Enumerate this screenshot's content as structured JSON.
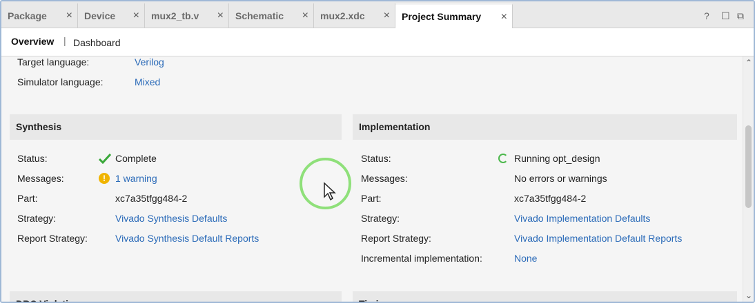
{
  "tabs": [
    {
      "label": "Package",
      "close": "×"
    },
    {
      "label": "Device",
      "close": "×"
    },
    {
      "label": "mux2_tb.v",
      "close": "×"
    },
    {
      "label": "Schematic",
      "close": "×"
    },
    {
      "label": "mux2.xdc",
      "close": "×"
    },
    {
      "label": "Project Summary",
      "close": "×"
    }
  ],
  "window_controls": {
    "help": "?",
    "restore": "☐",
    "float": "⧉"
  },
  "subtabs": {
    "overview": "Overview",
    "separator": "|",
    "dashboard": "Dashboard"
  },
  "settings": {
    "target_language_label": "Target language:",
    "target_language_value": "Verilog",
    "simulator_language_label": "Simulator language:",
    "simulator_language_value": "Mixed"
  },
  "synthesis": {
    "title": "Synthesis",
    "status_label": "Status:",
    "status_value": "Complete",
    "messages_label": "Messages:",
    "messages_value": "1 warning",
    "part_label": "Part:",
    "part_value": "xc7a35tfgg484-2",
    "strategy_label": "Strategy:",
    "strategy_value": "Vivado Synthesis Defaults",
    "report_strategy_label": "Report Strategy:",
    "report_strategy_value": "Vivado Synthesis Default Reports"
  },
  "implementation": {
    "title": "Implementation",
    "status_label": "Status:",
    "status_value": "Running opt_design",
    "messages_label": "Messages:",
    "messages_value": "No errors or warnings",
    "part_label": "Part:",
    "part_value": "xc7a35tfgg484-2",
    "strategy_label": "Strategy:",
    "strategy_value": "Vivado Implementation Defaults",
    "report_strategy_label": "Report Strategy:",
    "report_strategy_value": "Vivado Implementation Default Reports",
    "incremental_label": "Incremental implementation:",
    "incremental_value": "None"
  },
  "bottom_sections": {
    "left_title": "DRC Violations",
    "right_title": "Timing"
  },
  "icons": {
    "check": "check-icon",
    "warning": "warning-icon",
    "running": "running-spinner-icon"
  },
  "colors": {
    "link": "#2a6ab8",
    "success": "#3aa83a",
    "warning": "#f0b400",
    "section_header_bg": "#e8e8e8",
    "panel_bg": "#f5f5f5"
  }
}
